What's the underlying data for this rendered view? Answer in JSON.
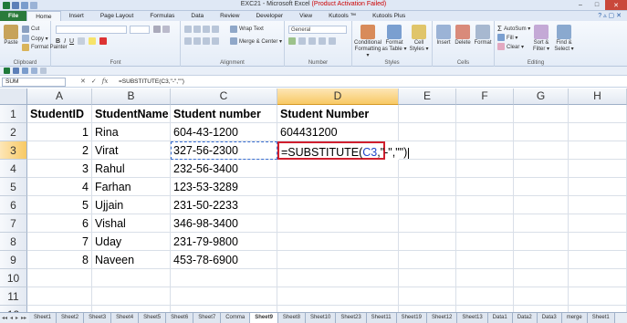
{
  "window": {
    "title_prefix": "EXC21 - Microsoft Excel",
    "title_suffix": "(Product Activation Failed)",
    "controls": [
      "–",
      "□",
      "✕"
    ]
  },
  "tabs": [
    "File",
    "Home",
    "Insert",
    "Page Layout",
    "Formulas",
    "Data",
    "Review",
    "Developer",
    "View",
    "Kutools ™",
    "Kutools Plus"
  ],
  "ribbon": {
    "clipboard": {
      "paste": "Paste",
      "cut": "Cut",
      "copy": "Copy ▾",
      "format_painter": "Format Painter",
      "label": "Clipboard"
    },
    "font": {
      "label": "Font"
    },
    "alignment": {
      "wrap_text": "Wrap Text",
      "merge_center": "Merge & Center ▾",
      "label": "Alignment"
    },
    "number": {
      "format": "General",
      "label": "Number"
    },
    "styles": {
      "conditional": [
        "Conditional",
        "Formatting ▾"
      ],
      "format_table": [
        "Format",
        "as Table ▾"
      ],
      "cell_styles": [
        "Cell",
        "Styles ▾"
      ],
      "label": "Styles"
    },
    "cells": {
      "insert": "Insert",
      "delete": "Delete",
      "format": "Format",
      "label": "Cells"
    },
    "editing": {
      "autosum": "AutoSum ▾",
      "fill": "Fill ▾",
      "clear": "Clear ▾",
      "sort": [
        "Sort &",
        "Filter ▾"
      ],
      "find": [
        "Find &",
        "Select ▾"
      ],
      "label": "Editing"
    }
  },
  "formula_bar": {
    "name_box": "SUM",
    "buttons": [
      "✕",
      "✓",
      "fx"
    ],
    "content": "=SUBSTITUTE(C3,\"-\",\"\")"
  },
  "columns": [
    "A",
    "B",
    "C",
    "D",
    "E",
    "F",
    "G",
    "H"
  ],
  "rows": [
    "1",
    "2",
    "3",
    "4",
    "5",
    "6",
    "7",
    "8",
    "9",
    "10",
    "11",
    "12"
  ],
  "cells": {
    "headers": [
      "StudentID",
      "StudentName",
      "Student number",
      "Student Number"
    ],
    "data": [
      [
        "1",
        "Rina",
        "604-43-1200",
        "604431200"
      ],
      [
        "2",
        "Virat",
        "327-56-2300",
        ""
      ],
      [
        "3",
        "Rahul",
        "232-56-3400",
        ""
      ],
      [
        "4",
        "Farhan",
        "123-53-3289",
        ""
      ],
      [
        "5",
        "Ujjain",
        "231-50-2233",
        ""
      ],
      [
        "6",
        "Vishal",
        "346-98-3400",
        ""
      ],
      [
        "7",
        "Uday",
        "231-79-9800",
        ""
      ],
      [
        "8",
        "Naveen",
        "453-78-6900",
        ""
      ]
    ],
    "active_formula": {
      "part1": "=SUBSTITUTE(",
      "ref": "C3",
      "part2": ",\"-\",\"\")"
    }
  },
  "sheet_tabs": [
    "Sheet1",
    "Sheet2",
    "Sheet3",
    "Sheet4",
    "Sheet5",
    "Sheet6",
    "Sheet7",
    "Comma",
    "Sheet9",
    "Sheet8",
    "Sheet10",
    "Sheet23",
    "Sheet11",
    "Sheet19",
    "Sheet12",
    "Sheet13",
    "Data1",
    "Data2",
    "Data3",
    "merge",
    "Sheet1"
  ],
  "active_sheet_tab": "Sheet9",
  "colors": {
    "file_tab": "#2a7a3b",
    "active_highlight": "#d01f2e",
    "ref_blue": "#2045c9"
  }
}
